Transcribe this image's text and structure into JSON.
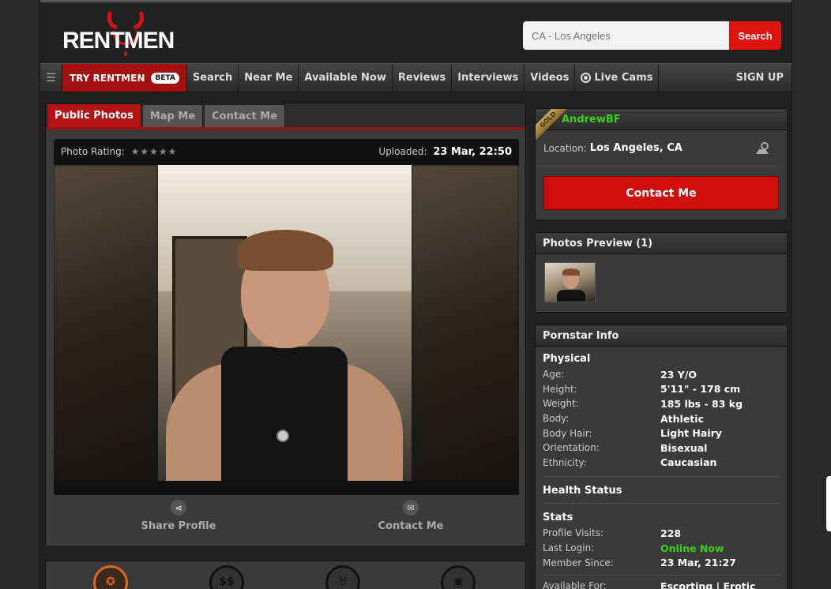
{
  "header": {
    "logo_text": "RENTMEN",
    "search_placeholder": "CA - Los Angeles",
    "search_button": "Search"
  },
  "nav": {
    "try_label": "TRY RENTMEN",
    "beta_badge": "BETA",
    "items": [
      "Search",
      "Near Me",
      "Available Now",
      "Reviews",
      "Interviews",
      "Videos",
      "Live Cams"
    ],
    "signup": "SIGN UP"
  },
  "tabs": [
    "Public Photos",
    "Map Me",
    "Contact Me"
  ],
  "photo": {
    "rating_label": "Photo Rating:",
    "stars": "★★★★★",
    "uploaded_label": "Uploaded:",
    "uploaded_value": "23 Mar, 22:50"
  },
  "actions": {
    "share": "Share Profile",
    "contact": "Contact Me"
  },
  "profile": {
    "badge": "GOLD",
    "username": "AndrewBF",
    "location_label": "Location:",
    "location_value": "Los Angeles, CA",
    "contact_button": "Contact Me"
  },
  "photos_preview": {
    "title": "Photos Preview (1)"
  },
  "pornstar_info": {
    "title": "Pornstar Info",
    "physical_title": "Physical",
    "physical": [
      {
        "k": "Age:",
        "v": "23 Y/O"
      },
      {
        "k": "Height:",
        "v": "5'11\" - 178 cm"
      },
      {
        "k": "Weight:",
        "v": "185 lbs - 83 kg"
      },
      {
        "k": "Body:",
        "v": "Athletic"
      },
      {
        "k": "Body Hair:",
        "v": "Light Hairy"
      },
      {
        "k": "Orientation:",
        "v": "Bisexual"
      },
      {
        "k": "Ethnicity:",
        "v": "Caucasian"
      }
    ],
    "health_title": "Health Status",
    "stats_title": "Stats",
    "stats": [
      {
        "k": "Profile Visits:",
        "v": "228"
      },
      {
        "k": "Last Login:",
        "v": "Online Now"
      },
      {
        "k": "Member Since:",
        "v": "23 Mar, 21:27"
      }
    ],
    "available_for": {
      "k": "Available For:",
      "v": "Escorting | Erotic"
    }
  },
  "colors": {
    "accent_red": "#d10e0e",
    "online_green": "#3ccf1b",
    "gold": "#c9a95a"
  }
}
